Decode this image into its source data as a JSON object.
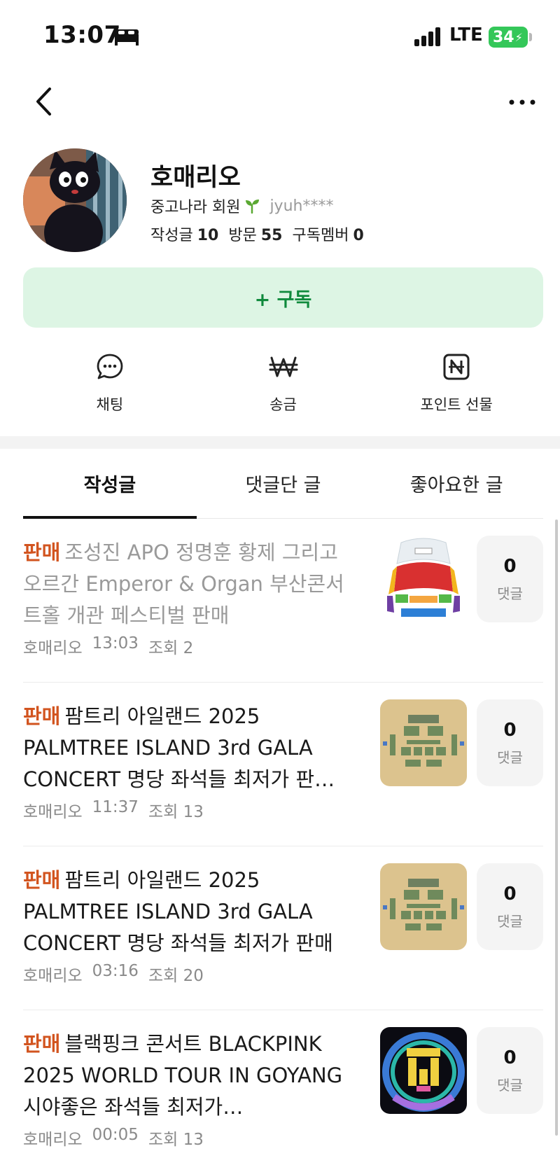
{
  "status_bar": {
    "time": "13:07",
    "network": "LTE",
    "battery": "34",
    "icons": [
      "bed-icon",
      "signal-icon",
      "battery-icon"
    ]
  },
  "nav": {
    "back_icon": "chevron-left-icon",
    "more_icon": "more-horizontal-icon"
  },
  "profile": {
    "name": "호매리오",
    "membership": "중고나라 회원",
    "membership_icon": "sprout-icon",
    "user_id": "jyuh****",
    "stats": [
      {
        "label": "작성글",
        "value": "10"
      },
      {
        "label": "방문",
        "value": "55"
      },
      {
        "label": "구독멤버",
        "value": "0"
      }
    ]
  },
  "subscribe_label": "+ 구독",
  "colors": {
    "accent_green": "#0f8a3c",
    "subscribe_bg": "#ddf5e4",
    "sale_badge": "#d2541f",
    "battery": "#34c759"
  },
  "actions": [
    {
      "label": "채팅",
      "icon": "chat-bubble-icon"
    },
    {
      "label": "송금",
      "icon": "won-icon"
    },
    {
      "label": "포인트 선물",
      "icon": "naver-point-icon"
    }
  ],
  "tabs": [
    {
      "label": "작성글",
      "active": true
    },
    {
      "label": "댓글단 글",
      "active": false
    },
    {
      "label": "좋아요한 글",
      "active": false
    }
  ],
  "posts": [
    {
      "badge": "판매",
      "title": "조성진 APO 정명훈 황제 그리고 오르간 Emperor & Organ 부산콘서트홀 개관 페스티벌  판매",
      "author": "호매리오",
      "time": "13:03",
      "views": "조회 2",
      "comments": "0",
      "comments_label": "댓글",
      "read": true,
      "thumb": "concert-hall-seatmap"
    },
    {
      "badge": "판매",
      "title": "팜트리 아일랜드 2025 PALMTREE ISLAND 3rd GALA CONCERT 명당 좌석들 최저가 판…",
      "author": "호매리오",
      "time": "11:37",
      "views": "조회 13",
      "comments": "0",
      "comments_label": "댓글",
      "read": false,
      "thumb": "stage-seatmap"
    },
    {
      "badge": "판매",
      "title": "팜트리 아일랜드 2025 PALMTREE ISLAND 3rd GALA CONCERT 명당 좌석들 최저가 판매",
      "author": "호매리오",
      "time": "03:16",
      "views": "조회 20",
      "comments": "0",
      "comments_label": "댓글",
      "read": false,
      "thumb": "stage-seatmap"
    },
    {
      "badge": "판매",
      "title": "블랙핑크 콘서트 BLACKPINK 2025 WORLD TOUR IN GOYANG 시야좋은 좌석들 최저가…",
      "author": "호매리오",
      "time": "00:05",
      "views": "조회 13",
      "comments": "0",
      "comments_label": "댓글",
      "read": false,
      "thumb": "stadium-seatmap"
    }
  ]
}
